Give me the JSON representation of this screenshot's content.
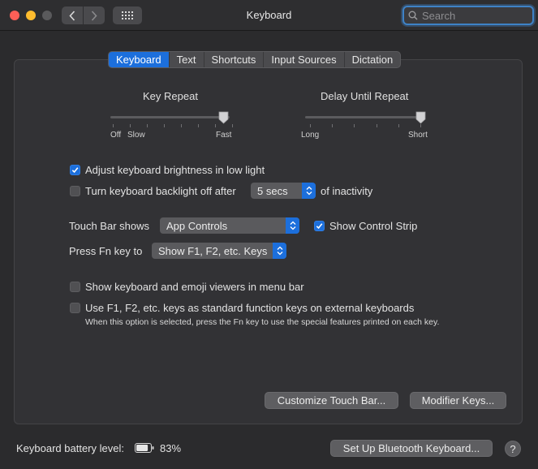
{
  "window": {
    "title": "Keyboard"
  },
  "search": {
    "placeholder": "Search"
  },
  "tabs": [
    {
      "label": "Keyboard",
      "active": true
    },
    {
      "label": "Text",
      "active": false
    },
    {
      "label": "Shortcuts",
      "active": false
    },
    {
      "label": "Input Sources",
      "active": false
    },
    {
      "label": "Dictation",
      "active": false
    }
  ],
  "key_repeat": {
    "title": "Key Repeat",
    "label_off": "Off",
    "label_slow": "Slow",
    "label_fast": "Fast",
    "level": 0.93
  },
  "delay_repeat": {
    "title": "Delay Until Repeat",
    "label_long": "Long",
    "label_short": "Short",
    "level": 1.0
  },
  "options": {
    "adjust_brightness": {
      "label": "Adjust keyboard brightness in low light",
      "checked": true
    },
    "backlight_off": {
      "label": "Turn keyboard backlight off after",
      "checked": false,
      "value": "5 secs",
      "suffix": "of inactivity"
    },
    "touch_bar": {
      "label": "Touch Bar shows",
      "value": "App Controls"
    },
    "control_strip": {
      "label": "Show Control Strip",
      "checked": true
    },
    "fn_key": {
      "label": "Press Fn key to",
      "value": "Show F1, F2, etc. Keys"
    },
    "emoji_viewers": {
      "label": "Show keyboard and emoji viewers in menu bar",
      "checked": false
    },
    "function_keys": {
      "label": "Use F1, F2, etc. keys as standard function keys on external keyboards",
      "checked": false,
      "note": "When this option is selected, press the Fn key to use the special features printed on each key."
    }
  },
  "buttons": {
    "customize": "Customize Touch Bar...",
    "modifier": "Modifier Keys...",
    "bluetooth": "Set Up Bluetooth Keyboard...",
    "help": "?"
  },
  "battery": {
    "label": "Keyboard battery level:",
    "percent": "83%",
    "level": 0.83
  },
  "colors": {
    "accent": "#1c6fdc",
    "background": "#2b2b2d",
    "panel": "#323235"
  }
}
